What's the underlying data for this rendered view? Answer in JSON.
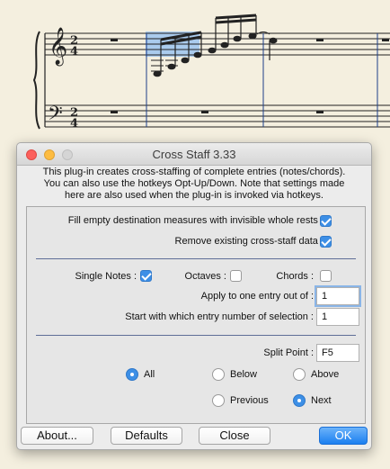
{
  "window": {
    "title": "Cross Staff 3.33"
  },
  "description": [
    "This plug-in creates cross-staffing of complete entries (notes/chords).",
    "You can also use the hotkeys Opt-Up/Down. Note that settings made",
    "here are also used when the plug-in is invoked via hotkeys."
  ],
  "options": {
    "fill_empty": {
      "label": "Fill empty destination measures with invisible whole rests :",
      "checked": true
    },
    "remove_existing": {
      "label": "Remove existing cross-staff data :",
      "checked": true
    }
  },
  "entry_types": {
    "single_notes": {
      "label": "Single Notes :",
      "checked": true
    },
    "octaves": {
      "label": "Octaves :",
      "checked": false
    },
    "chords": {
      "label": "Chords :",
      "checked": false
    }
  },
  "apply_one_of": {
    "label": "Apply to one entry out of :",
    "value": "1"
  },
  "start_entry": {
    "label": "Start with which entry number of selection :",
    "value": "1"
  },
  "split_point": {
    "label": "Split Point :",
    "value": "F5"
  },
  "radios": {
    "all": {
      "label": "All",
      "selected": true
    },
    "below": {
      "label": "Below",
      "selected": false
    },
    "above": {
      "label": "Above",
      "selected": false
    },
    "previous": {
      "label": "Previous",
      "selected": false
    },
    "next": {
      "label": "Next",
      "selected": true
    }
  },
  "buttons": {
    "about": "About...",
    "defaults": "Defaults",
    "close": "Close",
    "ok": "OK"
  },
  "score": {
    "time_signature_top": "2",
    "time_signature_bottom": "4"
  },
  "colors": {
    "accent": "#3d8fe6",
    "selection": "#9cc4f0",
    "barline": "#1e3f8a"
  }
}
